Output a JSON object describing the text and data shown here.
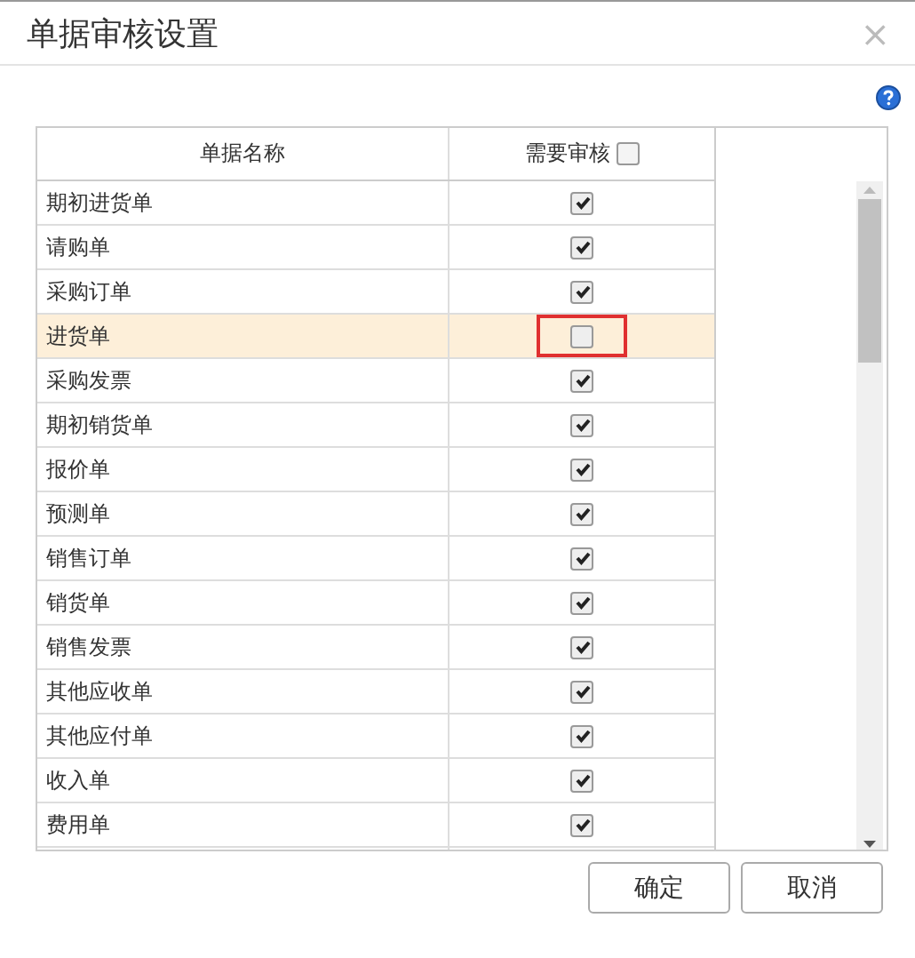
{
  "window": {
    "title": "单据审核设置",
    "close": "×"
  },
  "table": {
    "columns": [
      {
        "label": "单据名称"
      },
      {
        "label": "需要审核",
        "checked": false
      }
    ],
    "rows": [
      {
        "name": "期初进货单",
        "checked": true,
        "selected": false,
        "marked": false
      },
      {
        "name": "请购单",
        "checked": true,
        "selected": false,
        "marked": false
      },
      {
        "name": "采购订单",
        "checked": true,
        "selected": false,
        "marked": false
      },
      {
        "name": "进货单",
        "checked": false,
        "selected": true,
        "marked": true
      },
      {
        "name": "采购发票",
        "checked": true,
        "selected": false,
        "marked": false
      },
      {
        "name": "期初销货单",
        "checked": true,
        "selected": false,
        "marked": false
      },
      {
        "name": "报价单",
        "checked": true,
        "selected": false,
        "marked": false
      },
      {
        "name": "预测单",
        "checked": true,
        "selected": false,
        "marked": false
      },
      {
        "name": "销售订单",
        "checked": true,
        "selected": false,
        "marked": false
      },
      {
        "name": "销货单",
        "checked": true,
        "selected": false,
        "marked": false
      },
      {
        "name": "销售发票",
        "checked": true,
        "selected": false,
        "marked": false
      },
      {
        "name": "其他应收单",
        "checked": true,
        "selected": false,
        "marked": false
      },
      {
        "name": "其他应付单",
        "checked": true,
        "selected": false,
        "marked": false
      },
      {
        "name": "收入单",
        "checked": true,
        "selected": false,
        "marked": false
      },
      {
        "name": "费用单",
        "checked": true,
        "selected": false,
        "marked": false
      }
    ]
  },
  "buttons": [
    {
      "label": "确定"
    },
    {
      "label": "取消"
    }
  ]
}
